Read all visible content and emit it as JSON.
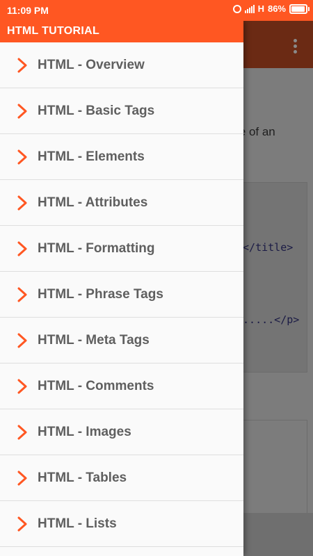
{
  "status_bar": {
    "time": "11:09 PM",
    "network": "H",
    "battery_percent": "86%",
    "battery_level": 0.86
  },
  "drawer": {
    "title": "HTML TUTORIAL",
    "items": [
      {
        "label": "HTML - Overview",
        "icon": "chevron-right-icon"
      },
      {
        "label": "HTML - Basic Tags",
        "icon": "chevron-right-icon"
      },
      {
        "label": "HTML - Elements",
        "icon": "chevron-right-icon"
      },
      {
        "label": "HTML - Attributes",
        "icon": "chevron-right-icon"
      },
      {
        "label": "HTML - Formatting",
        "icon": "chevron-right-icon"
      },
      {
        "label": "HTML - Phrase Tags",
        "icon": "chevron-right-icon"
      },
      {
        "label": "HTML - Meta Tags",
        "icon": "chevron-right-icon"
      },
      {
        "label": "HTML - Comments",
        "icon": "chevron-right-icon"
      },
      {
        "label": "HTML - Images",
        "icon": "chevron-right-icon"
      },
      {
        "label": "HTML - Tables",
        "icon": "chevron-right-icon"
      },
      {
        "label": "HTML - Lists",
        "icon": "chevron-right-icon"
      }
    ]
  },
  "background_page": {
    "text_fragment": "le of an",
    "code_lines": [
      "e</title>",
      "e.....</p>"
    ]
  },
  "colors": {
    "accent": "#ff5722",
    "chevron": "#ff5722",
    "item_text": "#5f5f5f",
    "drawer_bg": "#fafafa"
  }
}
